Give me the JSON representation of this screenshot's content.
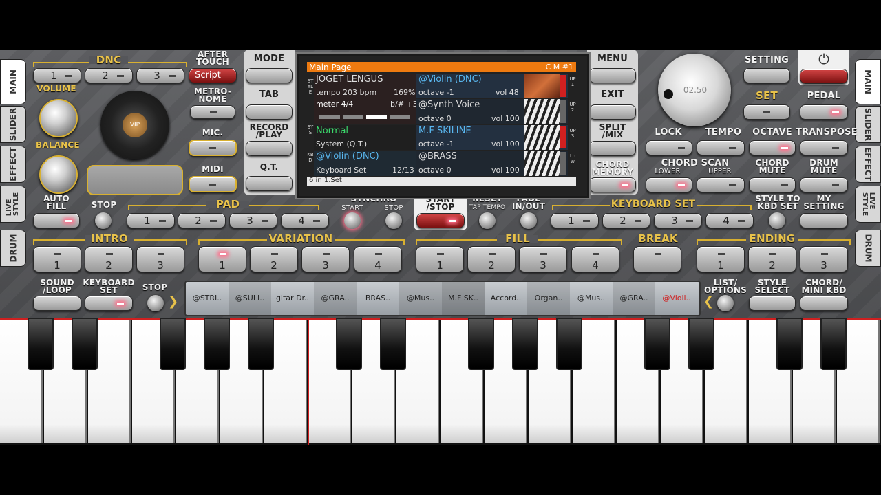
{
  "left_panel": {
    "dnc_label": "DNC",
    "dnc_buttons": [
      "1",
      "2",
      "3"
    ],
    "script_button": "Script",
    "after_touch_label": "AFTER\nTOUCH",
    "volume_label": "VOLUME",
    "balance_label": "BALANCE",
    "metronome_label": "METRO-\nNOME",
    "mic_label": "MIC.",
    "midi_label": "MIDI",
    "vip_label": "VIP"
  },
  "center_buttons": {
    "mode": "MODE",
    "tab": "TAB",
    "record_play": "RECORD\n/PLAY",
    "qt": "Q.T.",
    "menu": "MENU",
    "exit": "EXIT",
    "split_mix": "SPLIT\n/MIX",
    "chord_memory": "CHORD\nMEMORY"
  },
  "screen": {
    "header_left": "Main Page",
    "header_right": "C M #1",
    "style_name": "JOGET LENGUS",
    "tempo": "tempo 203 bpm",
    "tempo_pct": "169%",
    "meter": "meter 4/4",
    "transpose": "b/# +3",
    "sys_mode": "Normal",
    "sys_sub": "System (Q.T.)",
    "kbd_voice": "@Violin (DNC)",
    "kbd_set": "Keyboard Set",
    "kbd_count": "12/13",
    "up1_name": "@Violin (DNC)",
    "up1_octave": "octave -1",
    "up1_vol": "vol 48",
    "up2_name": "@Synth Voice",
    "up2_octave": "octave  0",
    "up2_vol": "vol 100",
    "up3_name": "M.F SKILINE",
    "up3_octave": "octave -1",
    "up3_vol": "vol 100",
    "low_name": "@BRASS",
    "low_octave": "octave  0",
    "low_vol": "vol 100",
    "footer": "6 in 1.Set",
    "left_tag_style": "STYLE",
    "left_tag_sys": "SYS",
    "left_tag_kbd": "KBD",
    "right_tag_up1": "UP1",
    "right_tag_up2": "UP2",
    "right_tag_up3": "UP3",
    "right_tag_low": "Low"
  },
  "right_panel": {
    "dial_value": "02.50",
    "setting": "SETTING",
    "set": "SET",
    "pedal": "PEDAL",
    "lock": "LOCK",
    "tempo": "TEMPO",
    "octave": "OCTAVE",
    "transpose": "TRANSPOSE",
    "chord_scan": "CHORD SCAN",
    "lower": "LOWER",
    "upper": "UPPER",
    "chord_mute": "CHORD\nMUTE",
    "drum_mute": "DRUM\nMUTE"
  },
  "tabs_left": [
    "MAIN",
    "SLIDER",
    "EFFECT",
    "LIVE\nSTYLE",
    "DRUM"
  ],
  "tabs_right": [
    "MAIN",
    "SLIDER",
    "EFFECT",
    "LIVE\nSTYLE",
    "DRUM"
  ],
  "row_pad": {
    "auto_fill": "AUTO\nFILL",
    "stop": "STOP",
    "pad": "PAD",
    "pad_buttons": [
      "1",
      "2",
      "3",
      "4"
    ],
    "synchro": "SYNCHRO",
    "synchro_start": "START",
    "synchro_stop": "STOP",
    "start_stop": "START\n/STOP",
    "reset": "RESET",
    "tap_tempo": "TAP TEMPO",
    "fade": "FADE\nIN/OUT",
    "keyboard_set": "KEYBOARD SET",
    "kbd_buttons": [
      "1",
      "2",
      "3",
      "4"
    ],
    "style_to_kbd": "STYLE TO\nKBD SET",
    "my_setting": "MY\nSETTING"
  },
  "row_sections": {
    "intro": "INTRO",
    "intro_buttons": [
      "1",
      "2",
      "3"
    ],
    "variation": "VARIATION",
    "variation_buttons": [
      "1",
      "2",
      "3",
      "4"
    ],
    "fill": "FILL",
    "fill_buttons": [
      "1",
      "2",
      "3",
      "4"
    ],
    "break": "BREAK",
    "ending": "ENDING",
    "ending_buttons": [
      "1",
      "2",
      "3"
    ]
  },
  "row_bottom": {
    "sound_loop": "SOUND\n/LOOP",
    "keyboard_set": "KEYBOARD\nSET",
    "stop": "STOP",
    "list_options": "LIST/\nOPTIONS",
    "style_select": "STYLE\nSELECT",
    "chord_mini": "CHORD/\nMINI KBD",
    "strip": [
      "@STRI..",
      "@SULI..",
      "gitar Dr..",
      "@GRA..",
      "BRAS..",
      "@Mus..",
      "M.F SK..",
      "Accord..",
      "Organ..",
      "@Mus..",
      "@GRA..",
      "@Violi.."
    ]
  },
  "colors": {
    "accent": "#e8c24a",
    "header": "#ee7a10",
    "active_voice": "#d02020"
  }
}
